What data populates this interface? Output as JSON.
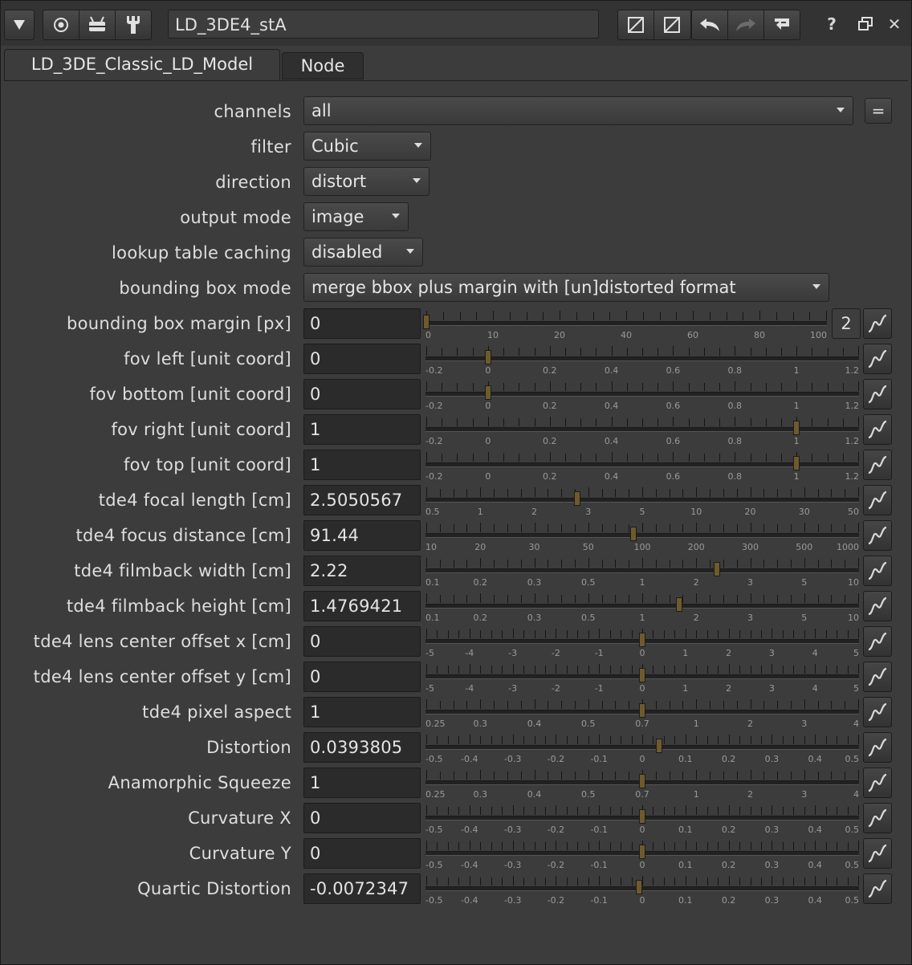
{
  "header": {
    "node_name": "LD_3DE4_stA",
    "icons": [
      "collapse-arrow-icon",
      "viewer-icon",
      "node-graph-icon",
      "wrench-icon",
      "color-chip-icon-1",
      "color-chip-icon-2",
      "undo-icon",
      "redo-icon",
      "revert-icon",
      "help-icon",
      "float-icon",
      "close-icon"
    ],
    "help_glyph": "?",
    "close_glyph": "✕"
  },
  "tabs": [
    {
      "label": "LD_3DE_Classic_LD_Model",
      "active": true
    },
    {
      "label": "Node",
      "active": false
    }
  ],
  "dropdowns": [
    {
      "label": "channels",
      "value": "all"
    },
    {
      "label": "filter",
      "value": "Cubic"
    },
    {
      "label": "direction",
      "value": "distort"
    },
    {
      "label": "output mode",
      "value": "image"
    },
    {
      "label": "lookup table caching",
      "value": "disabled"
    },
    {
      "label": "bounding box mode",
      "value": "merge bbox plus margin with [un]distorted format"
    }
  ],
  "channels_link_button": "=",
  "multiplier_button": "2",
  "knobs": [
    {
      "label": "bounding box margin [px]",
      "value": "0",
      "ticks": [
        "0",
        "10",
        "20",
        "40",
        "60",
        "80",
        "100"
      ],
      "pos": 0
    },
    {
      "label": "fov left [unit coord]",
      "value": "0",
      "ticks": [
        "-0.2",
        "0",
        "0.2",
        "0.4",
        "0.6",
        "0.8",
        "1",
        "1.2"
      ],
      "pos": 0.142857
    },
    {
      "label": "fov bottom [unit coord]",
      "value": "0",
      "ticks": [
        "-0.2",
        "0",
        "0.2",
        "0.4",
        "0.6",
        "0.8",
        "1",
        "1.2"
      ],
      "pos": 0.142857
    },
    {
      "label": "fov right [unit coord]",
      "value": "1",
      "ticks": [
        "-0.2",
        "0",
        "0.2",
        "0.4",
        "0.6",
        "0.8",
        "1",
        "1.2"
      ],
      "pos": 0.857143
    },
    {
      "label": "fov top [unit coord]",
      "value": "1",
      "ticks": [
        "-0.2",
        "0",
        "0.2",
        "0.4",
        "0.6",
        "0.8",
        "1",
        "1.2"
      ],
      "pos": 0.857143
    },
    {
      "label": "tde4 focal length [cm]",
      "value": "2.5050567",
      "ticks": [
        "0.5",
        "1",
        "2",
        "3",
        "5",
        "10",
        "20",
        "30",
        "50"
      ],
      "pos": 0.35
    },
    {
      "label": "tde4 focus distance [cm]",
      "value": "91.44",
      "ticks": [
        "10",
        "20",
        "30",
        "50",
        "100",
        "200",
        "300",
        "500",
        "1000"
      ],
      "pos": 0.48
    },
    {
      "label": "tde4 filmback width [cm]",
      "value": "2.22",
      "ticks": [
        "0.1",
        "0.2",
        "0.3",
        "0.5",
        "1",
        "2",
        "3",
        "5",
        "10"
      ],
      "pos": 0.673
    },
    {
      "label": "tde4 filmback height [cm]",
      "value": "1.4769421",
      "ticks": [
        "0.1",
        "0.2",
        "0.3",
        "0.5",
        "1",
        "2",
        "3",
        "5",
        "10"
      ],
      "pos": 0.585
    },
    {
      "label": "tde4 lens center offset x [cm]",
      "value": "0",
      "ticks": [
        "-5",
        "-4",
        "-3",
        "-2",
        "-1",
        "0",
        "1",
        "2",
        "3",
        "4",
        "5"
      ],
      "pos": 0.5
    },
    {
      "label": "tde4 lens center offset y [cm]",
      "value": "0",
      "ticks": [
        "-5",
        "-4",
        "-3",
        "-2",
        "-1",
        "0",
        "1",
        "2",
        "3",
        "4",
        "5"
      ],
      "pos": 0.5
    },
    {
      "label": "tde4 pixel aspect",
      "value": "1",
      "ticks": [
        "0.25",
        "0.3",
        "0.4",
        "0.5",
        "0.7",
        "1",
        "2",
        "3",
        "4"
      ],
      "pos": 0.5
    },
    {
      "label": "Distortion",
      "value": "0.0393805",
      "ticks": [
        "-0.5",
        "-0.4",
        "-0.3",
        "-0.2",
        "-0.1",
        "0",
        "0.1",
        "0.2",
        "0.3",
        "0.4",
        "0.5"
      ],
      "pos": 0.539
    },
    {
      "label": "Anamorphic Squeeze",
      "value": "1",
      "ticks": [
        "0.25",
        "0.3",
        "0.4",
        "0.5",
        "0.7",
        "1",
        "2",
        "3",
        "4"
      ],
      "pos": 0.5
    },
    {
      "label": "Curvature X",
      "value": "0",
      "ticks": [
        "-0.5",
        "-0.4",
        "-0.3",
        "-0.2",
        "-0.1",
        "0",
        "0.1",
        "0.2",
        "0.3",
        "0.4",
        "0.5"
      ],
      "pos": 0.5
    },
    {
      "label": "Curvature Y",
      "value": "0",
      "ticks": [
        "-0.5",
        "-0.4",
        "-0.3",
        "-0.2",
        "-0.1",
        "0",
        "0.1",
        "0.2",
        "0.3",
        "0.4",
        "0.5"
      ],
      "pos": 0.5
    },
    {
      "label": "Quartic Distortion",
      "value": "-0.0072347",
      "ticks": [
        "-0.5",
        "-0.4",
        "-0.3",
        "-0.2",
        "-0.1",
        "0",
        "0.1",
        "0.2",
        "0.3",
        "0.4",
        "0.5"
      ],
      "pos": 0.493
    }
  ],
  "colors": {
    "panel_bg": "#3c3c3c",
    "field_bg": "#2b2b2b",
    "handle": "#6e5a2c",
    "text": "#dcdcdc"
  }
}
